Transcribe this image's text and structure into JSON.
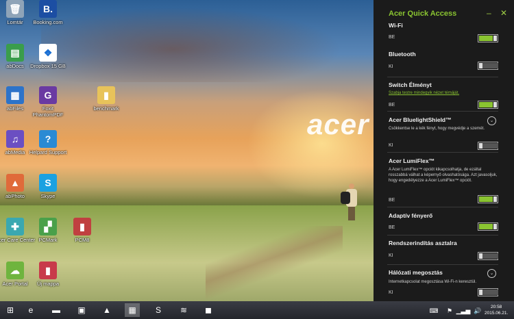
{
  "desktop": {
    "wallpaper_logo": "acer",
    "icons": [
      {
        "label": "Lomtár",
        "icon": "recycle-bin-icon",
        "color": "#8fa4b8",
        "glyph": "🗑"
      },
      {
        "label": "Booking.com",
        "icon": "booking-icon",
        "color": "#1c4ea3",
        "glyph": "B."
      },
      {
        "label": "abDocs",
        "icon": "abdocs-icon",
        "color": "#3a9d4c",
        "glyph": "▤"
      },
      {
        "label": "Dropbox 15 GB",
        "icon": "dropbox-icon",
        "color": "#ffffff",
        "glyph": "❖"
      },
      {
        "label": "abFiles",
        "icon": "abfiles-icon",
        "color": "#2d73c9",
        "glyph": "▦"
      },
      {
        "label": "Foxit PhantomPDF",
        "icon": "foxit-icon",
        "color": "#6a3aa2",
        "glyph": "G"
      },
      {
        "label": "benchmark",
        "icon": "folder-icon",
        "color": "#e8c35a",
        "glyph": "▮"
      },
      {
        "label": "abMedia",
        "icon": "abmedia-icon",
        "color": "#6b4fc2",
        "glyph": "♫"
      },
      {
        "label": "Helpard Support",
        "icon": "help-icon",
        "color": "#2a8ad4",
        "glyph": "?"
      },
      {
        "label": "abPhoto",
        "icon": "abphoto-icon",
        "color": "#e06a3a",
        "glyph": "▲"
      },
      {
        "label": "Skype",
        "icon": "skype-icon",
        "color": "#1aa1e1",
        "glyph": "S"
      },
      {
        "label": "Acer Care Center",
        "icon": "acer-care-icon",
        "color": "#3aa8b0",
        "glyph": "✚"
      },
      {
        "label": "PCMark",
        "icon": "pcmark-icon",
        "color": "#4aa04a",
        "glyph": "▞"
      },
      {
        "label": "PCM8",
        "icon": "pcm8-icon",
        "color": "#c04040",
        "glyph": "▮"
      },
      {
        "label": "Acer Portal",
        "icon": "acer-portal-icon",
        "color": "#6fb43e",
        "glyph": "☁"
      },
      {
        "label": "Új mappa",
        "icon": "new-folder-icon",
        "color": "#c83a4a",
        "glyph": "▮"
      }
    ]
  },
  "panel": {
    "title": "Acer Quick Access",
    "minimize": "–",
    "close": "✕",
    "sections": [
      {
        "title": "Wi-Fi",
        "desc": "",
        "link": "",
        "state": "BE",
        "on": true,
        "chevron": false
      },
      {
        "title": "Bluetooth",
        "desc": "",
        "link": "",
        "state": "KI",
        "on": false,
        "chevron": false
      },
      {
        "title": "Switch Élményt",
        "desc": "",
        "link": "Szabja testre mindegyik nézet témáját.",
        "state": "BE",
        "on": true,
        "chevron": false
      },
      {
        "title": "Acer BluelightShield™",
        "desc": "Csökkentse le a kék fényt, hogy megvédje a szemét.",
        "link": "",
        "state": "KI",
        "on": false,
        "chevron": true
      },
      {
        "title": "Acer LumiFlex™",
        "desc": "A Acer LumiFlex™ opciót kikapcsolhatja, de ezáltal rosszabbá válhat a képernyő olvashatósága. Azt javasoljuk, hogy engedélyezze a Acer LumiFlex™ opciót.",
        "link": "",
        "state": "BE",
        "on": true,
        "chevron": false
      },
      {
        "title": "Adaptív fényerő",
        "desc": "",
        "link": "",
        "state": "BE",
        "on": true,
        "chevron": false
      },
      {
        "title": "Rendszerindítás asztalra",
        "desc": "",
        "link": "",
        "state": "KI",
        "on": false,
        "chevron": false
      },
      {
        "title": "Hálózati megosztás",
        "desc": "Internetkapcsolat megosztása Wi-Fi-n keresztül.",
        "link": "",
        "state": "KI",
        "on": false,
        "chevron": true
      }
    ]
  },
  "taskbar": {
    "items": [
      {
        "icon": "start-icon",
        "glyph": "⊞"
      },
      {
        "icon": "internet-explorer-icon",
        "glyph": "e"
      },
      {
        "icon": "file-explorer-icon",
        "glyph": "▬"
      },
      {
        "icon": "store-icon",
        "glyph": "▣"
      },
      {
        "icon": "photo-app-icon",
        "glyph": "▲"
      },
      {
        "icon": "acer-quick-access-icon",
        "glyph": "▦"
      },
      {
        "icon": "skype-icon",
        "glyph": "S"
      },
      {
        "icon": "spotify-icon",
        "glyph": "≋"
      },
      {
        "icon": "media-icon",
        "glyph": "◼"
      }
    ],
    "time": "20:58",
    "date": "2015.06.21."
  }
}
